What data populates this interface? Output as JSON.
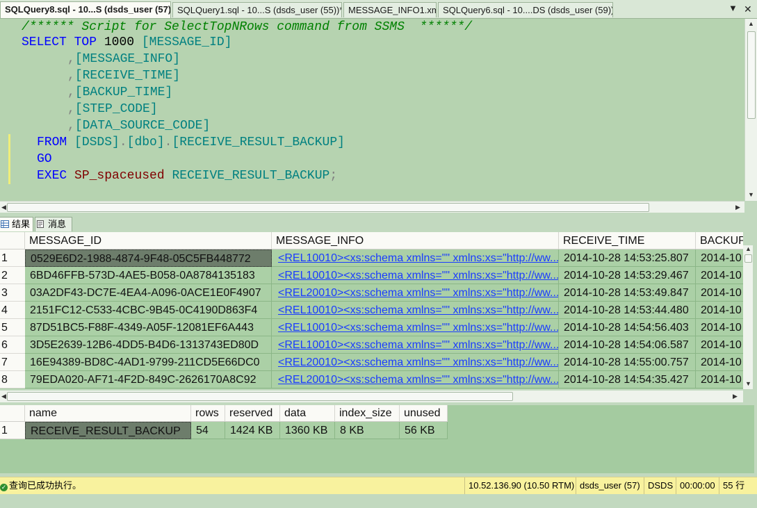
{
  "tabs": [
    {
      "label": "SQLQuery8.sql - 10...S (dsds_user (57))*",
      "active": true
    },
    {
      "label": "SQLQuery1.sql - 10...S (dsds_user (55))*",
      "active": false
    },
    {
      "label": "MESSAGE_INFO1.xml",
      "active": false
    },
    {
      "label": "SQLQuery6.sql - 10....DS (dsds_user (59))",
      "active": false
    }
  ],
  "tab_close": "✕",
  "editor": {
    "line1": "/****** Script for SelectTopNRows command from SSMS  ******/",
    "select_kw": "SELECT",
    "top_kw": "TOP",
    "top_n": "1000",
    "col1": "[MESSAGE_ID]",
    "comma": ",",
    "col2": "[MESSAGE_INFO]",
    "col3": "[RECEIVE_TIME]",
    "col4": "[BACKUP_TIME]",
    "col5": "[STEP_CODE]",
    "col6": "[DATA_SOURCE_CODE]",
    "from_kw": "FROM",
    "from_db": "[DSDS]",
    "dot": ".",
    "from_schema": "[dbo]",
    "from_table": "[RECEIVE_RESULT_BACKUP]",
    "go_kw": "GO",
    "exec_kw": "EXEC",
    "proc": "SP_spaceused",
    "proc_arg": "RECEIVE_RESULT_BACKUP",
    "semi": ";"
  },
  "result_tabs": [
    {
      "label": "结果",
      "icon": "grid-icon"
    },
    {
      "label": "消息",
      "icon": "message-icon"
    }
  ],
  "grid1": {
    "columns": [
      "MESSAGE_ID",
      "MESSAGE_INFO",
      "RECEIVE_TIME",
      "BACKUP_"
    ],
    "rows": [
      {
        "n": "1",
        "id": "0529E6D2-1988-4874-9F48-05C5FB448772",
        "info": "<REL10010><xs:schema xmlns=\"\" xmlns:xs=\"http://ww...",
        "time": "2014-10-28 14:53:25.807",
        "backup": "2014-10"
      },
      {
        "n": "2",
        "id": "6BD46FFB-573D-4AE5-B058-0A8784135183",
        "info": "<REL10010><xs:schema xmlns=\"\" xmlns:xs=\"http://ww...",
        "time": "2014-10-28 14:53:29.467",
        "backup": "2014-10"
      },
      {
        "n": "3",
        "id": "03A2DF43-DC7E-4EA4-A096-0ACE1E0F4907",
        "info": "<REL20010><xs:schema xmlns=\"\" xmlns:xs=\"http://ww...",
        "time": "2014-10-28 14:53:49.847",
        "backup": "2014-10"
      },
      {
        "n": "4",
        "id": "2151FC12-C533-4CBC-9B45-0C4190D863F4",
        "info": "<REL10010><xs:schema xmlns=\"\" xmlns:xs=\"http://ww...",
        "time": "2014-10-28 14:53:44.480",
        "backup": "2014-10"
      },
      {
        "n": "5",
        "id": "87D51BC5-F88F-4349-A05F-12081EF6A443",
        "info": "<REL10010><xs:schema xmlns=\"\" xmlns:xs=\"http://ww...",
        "time": "2014-10-28 14:54:56.403",
        "backup": "2014-10"
      },
      {
        "n": "6",
        "id": "3D5E2639-12B6-4DD5-B4D6-1313743ED80D",
        "info": "<REL10010><xs:schema xmlns=\"\" xmlns:xs=\"http://ww...",
        "time": "2014-10-28 14:54:06.587",
        "backup": "2014-10"
      },
      {
        "n": "7",
        "id": "16E94389-BD8C-4AD1-9799-211CD5E66DC0",
        "info": "<REL20010><xs:schema xmlns=\"\" xmlns:xs=\"http://ww...",
        "time": "2014-10-28 14:55:00.757",
        "backup": "2014-10"
      },
      {
        "n": "8",
        "id": "79EDA020-AF71-4F2D-849C-2626170A8C92",
        "info": "<REL20010><xs:schema xmlns=\"\" xmlns:xs=\"http://ww...",
        "time": "2014-10-28 14:54:35.427",
        "backup": "2014-10"
      }
    ]
  },
  "grid2": {
    "columns": [
      "name",
      "rows",
      "reserved",
      "data",
      "index_size",
      "unused"
    ],
    "row": {
      "n": "1",
      "name": "RECEIVE_RESULT_BACKUP",
      "rows": "54",
      "reserved": "1424 KB",
      "data": "1360 KB",
      "index_size": "8 KB",
      "unused": "56 KB"
    }
  },
  "status": {
    "message": "查询已成功执行。",
    "server": "10.52.136.90 (10.50 RTM)",
    "user": "dsds_user (57)",
    "database": "DSDS",
    "elapsed": "00:00:00",
    "row_count": "55 行"
  },
  "colors": {
    "editor_bg": "#b6d3b0",
    "grid_bg": "#abd0a6",
    "keyword": "#0000ff",
    "comment": "#008000",
    "status_bg": "#f8f29e"
  }
}
